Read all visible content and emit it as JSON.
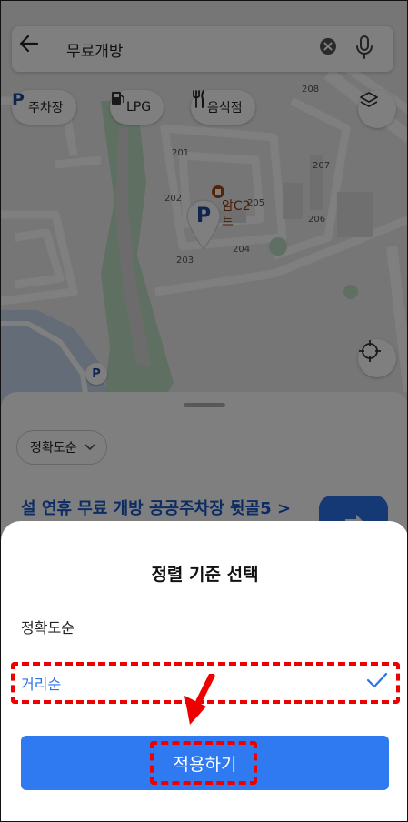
{
  "search": {
    "query": "무료개방"
  },
  "chips": [
    {
      "label": "주차장",
      "icon": "parking-icon"
    },
    {
      "label": "LPG",
      "icon": "gas-station-icon"
    },
    {
      "label": "음식점",
      "icon": "restaurant-icon"
    }
  ],
  "map": {
    "building_numbers": [
      "208",
      "207",
      "201",
      "202",
      "205",
      "206",
      "204",
      "203"
    ],
    "apartment_label": "암C2\n트",
    "marker_letter": "P"
  },
  "list": {
    "sort_label": "정확도순",
    "first_result_title": "설 연휴 무료 개방 공공주차장 뒷골5 >"
  },
  "sort_sheet": {
    "title": "정렬 기준 선택",
    "options": [
      {
        "label": "정확도순",
        "selected": false
      },
      {
        "label": "거리순",
        "selected": true
      }
    ],
    "apply_label": "적용하기"
  },
  "colors": {
    "accent": "#2f7af0",
    "selected_text": "#2a72e8",
    "annotation": "#e00000"
  }
}
